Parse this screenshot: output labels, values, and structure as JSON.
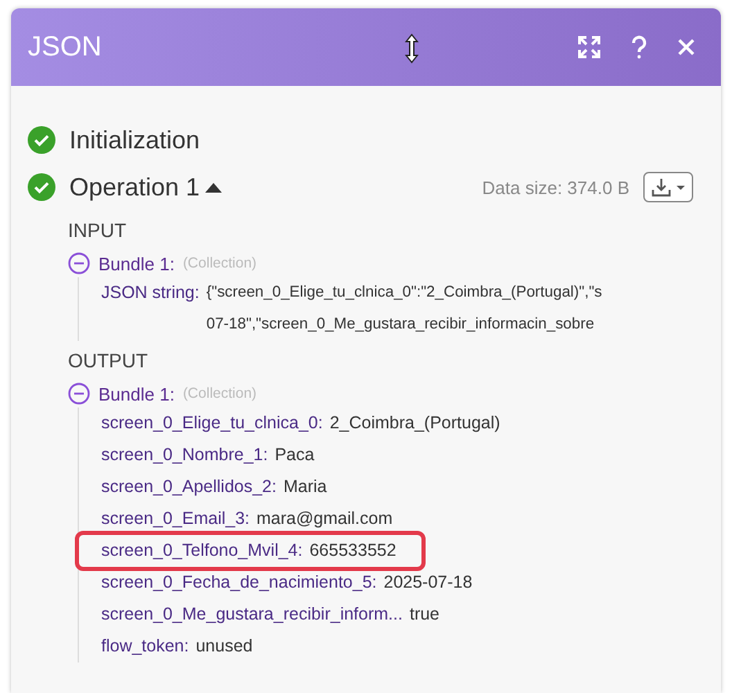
{
  "window": {
    "title": "JSON"
  },
  "stages": [
    {
      "label": "Initialization",
      "completed": true,
      "expanded": false
    },
    {
      "label": "Operation 1",
      "completed": true,
      "expanded": true
    }
  ],
  "data_size": "Data size: 374.0 B",
  "input": {
    "heading": "INPUT",
    "bundle": {
      "label": "Bundle 1:",
      "type": "(Collection)",
      "expanded": true,
      "items": [
        {
          "key": "JSON string:",
          "value_lines": [
            "{\"screen_0_Elige_tu_clnica_0\":\"2_Coimbra_(Portugal)\",\"s",
            "07-18\",\"screen_0_Me_gustara_recibir_informacin_sobre"
          ]
        }
      ]
    }
  },
  "output": {
    "heading": "OUTPUT",
    "bundle": {
      "label": "Bundle 1:",
      "type": "(Collection)",
      "expanded": true,
      "items": [
        {
          "key": "screen_0_Elige_tu_clnica_0:",
          "value": "2_Coimbra_(Portugal)",
          "highlighted": false
        },
        {
          "key": "screen_0_Nombre_1:",
          "value": "Paca",
          "highlighted": false
        },
        {
          "key": "screen_0_Apellidos_2:",
          "value": "Maria",
          "highlighted": false
        },
        {
          "key": "screen_0_Email_3:",
          "value": "mara@gmail.com",
          "highlighted": false
        },
        {
          "key": "screen_0_Telfono_Mvil_4:",
          "value": "665533552",
          "highlighted": true
        },
        {
          "key": "screen_0_Fecha_de_nacimiento_5:",
          "value": "2025-07-18",
          "highlighted": false
        },
        {
          "key": "screen_0_Me_gustara_recibir_inform...",
          "value": "true",
          "highlighted": false
        },
        {
          "key": "flow_token:",
          "value": "unused",
          "highlighted": false
        }
      ]
    }
  }
}
